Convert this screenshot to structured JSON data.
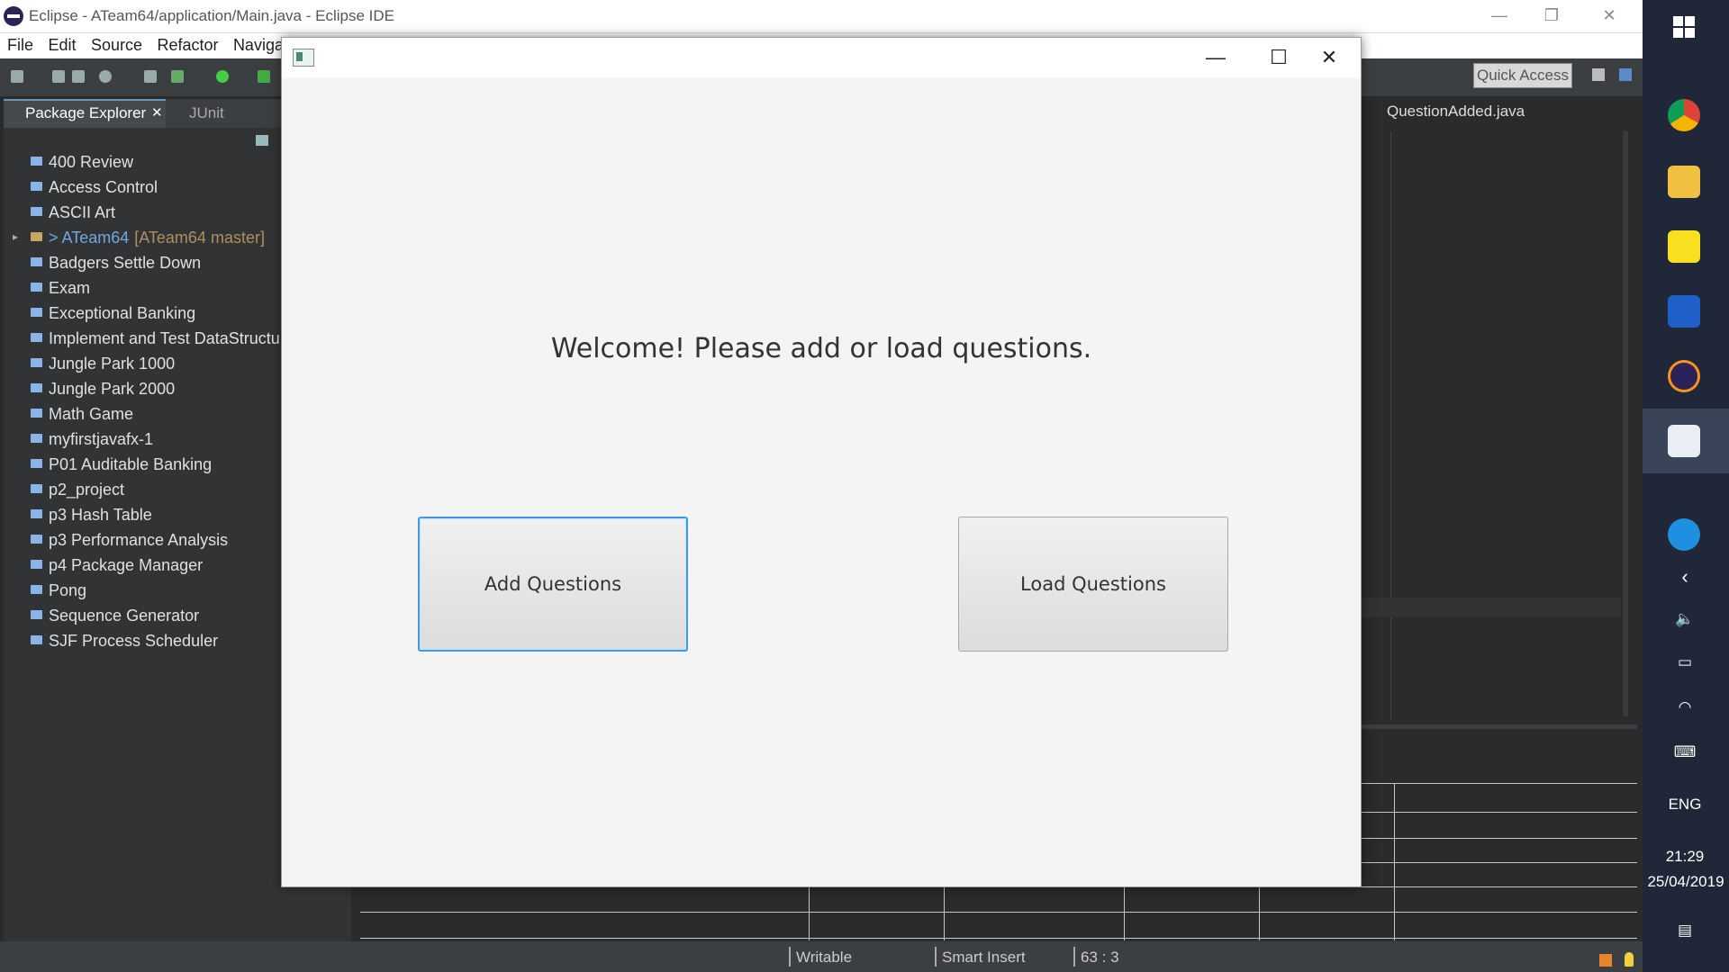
{
  "window": {
    "title": "Eclipse - ATeam64/application/Main.java - Eclipse IDE",
    "controls": {
      "minimize": "—",
      "restore": "❐",
      "close": "✕"
    }
  },
  "menu": [
    "File",
    "Edit",
    "Source",
    "Refactor",
    "Navigate"
  ],
  "toolbar": {
    "quick_access": "Quick Access"
  },
  "package_explorer": {
    "tabs": [
      "Package Explorer",
      "JUnit"
    ],
    "tab_close": "✕",
    "items": [
      {
        "label": "400 Review"
      },
      {
        "label": "Access Control"
      },
      {
        "label": "ASCII Art"
      },
      {
        "label": "> ATeam64",
        "suffix": "[ATeam64 master]",
        "git": true
      },
      {
        "label": "Badgers Settle Down"
      },
      {
        "label": "Exam"
      },
      {
        "label": "Exceptional Banking"
      },
      {
        "label": "Implement and Test DataStructur"
      },
      {
        "label": "Jungle Park 1000"
      },
      {
        "label": "Jungle Park 2000"
      },
      {
        "label": "Math Game"
      },
      {
        "label": "myfirstjavafx-1"
      },
      {
        "label": "P01 Auditable Banking"
      },
      {
        "label": "p2_project"
      },
      {
        "label": "p3 Hash Table"
      },
      {
        "label": "p3 Performance Analysis"
      },
      {
        "label": "p4 Package Manager"
      },
      {
        "label": "Pong"
      },
      {
        "label": "Sequence Generator"
      },
      {
        "label": "SJF Process Scheduler"
      }
    ]
  },
  "editor": {
    "tab": "QuestionAdded.java"
  },
  "status": {
    "writable": "Writable",
    "insert_mode": "Smart Insert",
    "position": "63 : 3"
  },
  "dialog": {
    "welcome": "Welcome! Please add or load questions.",
    "add_button": "Add Questions",
    "load_button": "Load Questions",
    "controls": {
      "minimize": "—",
      "maximize": "☐",
      "close": "✕"
    }
  },
  "taskbar": {
    "language": "ENG",
    "time": "21:29",
    "date": "25/04/2019"
  },
  "colors": {
    "accent_focus": "#3c9be8",
    "ide_background": "#2b2b2b",
    "taskbar": "#1f2738"
  }
}
